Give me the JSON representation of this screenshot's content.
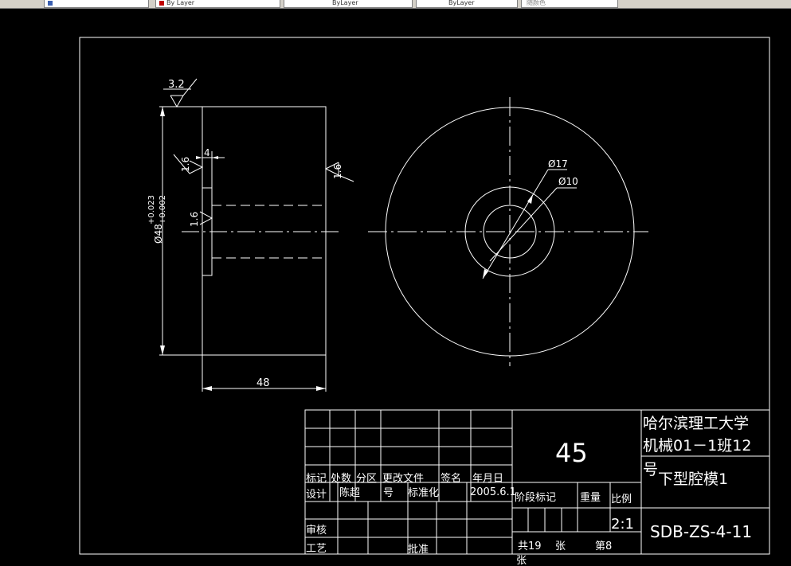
{
  "taskbar": {
    "tabs": [
      {
        "label": "",
        "color": "#3a5fb0"
      },
      {
        "label": "By Layer",
        "color": "#c00000"
      },
      {
        "label": "ByLayer",
        "color": "#ffffff"
      },
      {
        "label": "ByLayer",
        "color": "#ffffff"
      },
      {
        "label": "随颜色",
        "color": "#ffffff"
      }
    ]
  },
  "drawing": {
    "roughness_top": "3.2",
    "roughness_face_small": "1.6",
    "roughness_bore": "1.6",
    "roughness_right": "1.6",
    "groove_depth": "4",
    "diameter_label": "Ø48",
    "tol_upper": "+0.023",
    "tol_lower": "+0.002",
    "width_dim": "48",
    "dia17": "Ø17",
    "dia10": "Ø10"
  },
  "title_block": {
    "university_line1": "哈尔滨理工大学",
    "university_line2": "机械01－1班12",
    "university_line3": "号",
    "part_name": "下型腔模1",
    "material": "45",
    "drawing_no": "SDB-ZS-4-11",
    "scale": "2:1",
    "stage_mark": "阶段标记",
    "weight": "重量",
    "ratio": "比例",
    "total_sheets": "共19",
    "sheet_unit1": "张",
    "sheet_no": "第8",
    "sheet_unit2": "张",
    "header_mark": "标记",
    "header_count": "处数",
    "header_zone": "分区",
    "header_docno": "更改文件",
    "header_docno2": "号",
    "header_sign": "签名",
    "header_date": "年月日",
    "design": "设计",
    "designer": "陈超",
    "standardize": "标准化",
    "design_date": "2005.6.1",
    "review": "审核",
    "process": "工艺",
    "approve": "批准"
  }
}
